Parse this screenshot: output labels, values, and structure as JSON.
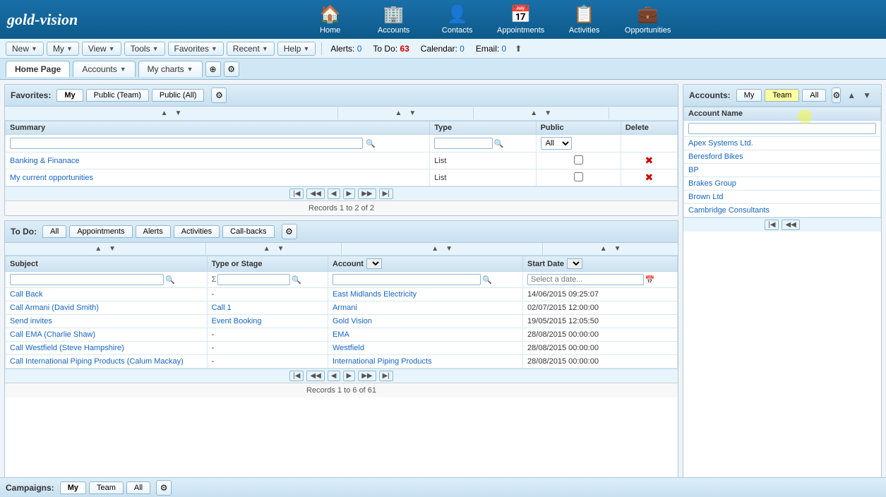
{
  "logo": {
    "text1": "gold-",
    "text2": "vision"
  },
  "nav": {
    "icons": [
      {
        "name": "home",
        "label": "Home",
        "symbol": "🏠"
      },
      {
        "name": "accounts",
        "label": "Accounts",
        "symbol": "🏢"
      },
      {
        "name": "contacts",
        "label": "Contacts",
        "symbol": "👤"
      },
      {
        "name": "appointments",
        "label": "Appointments",
        "symbol": "📅"
      },
      {
        "name": "activities",
        "label": "Activities",
        "symbol": "📋"
      },
      {
        "name": "opportunities",
        "label": "Opportunities",
        "symbol": "💼"
      }
    ]
  },
  "toolbar": {
    "new_label": "New",
    "my_label": "My",
    "view_label": "View",
    "tools_label": "Tools",
    "favorites_label": "Favorites",
    "recent_label": "Recent",
    "help_label": "Help",
    "alerts_label": "Alerts:",
    "alerts_count": "0",
    "todo_label": "To Do:",
    "todo_count": "63",
    "calendar_label": "Calendar:",
    "calendar_count": "0",
    "email_label": "Email:",
    "email_count": "0"
  },
  "tabs": {
    "home_page": "Home Page",
    "accounts": "Accounts",
    "my_charts": "My charts"
  },
  "favorites": {
    "label": "Favorites:",
    "tabs": [
      "My",
      "Public (Team)",
      "Public (All)"
    ],
    "columns": [
      "Summary",
      "Type",
      "Public",
      "Delete"
    ],
    "rows": [
      {
        "summary": "Banking & Finanace",
        "type": "List",
        "public": false,
        "delete": true
      },
      {
        "summary": "My current opportunities",
        "type": "List",
        "public": false,
        "delete": true
      }
    ],
    "records_info": "Records 1 to 2 of 2"
  },
  "todo": {
    "label": "To Do:",
    "tabs": [
      "All",
      "Appointments",
      "Alerts",
      "Activities",
      "Call-backs"
    ],
    "active_tab": "All",
    "columns": [
      "Subject",
      "Type or Stage",
      "Account",
      "Start Date"
    ],
    "rows": [
      {
        "subject": "Call Back",
        "type": "-",
        "account": "East Midlands Electricity",
        "start_date": "14/06/2015 09:25:07"
      },
      {
        "subject": "Call Armani (David Smith)",
        "type": "Call 1",
        "account": "Armani",
        "start_date": "02/07/2015 12:00:00"
      },
      {
        "subject": "Send invites",
        "type": "Event Booking",
        "account": "Gold Vision",
        "start_date": "19/05/2015 12:05:50"
      },
      {
        "subject": "Call EMA (Charlie Shaw)",
        "type": "-",
        "account": "EMA",
        "start_date": "28/08/2015 00:00:00"
      },
      {
        "subject": "Call Westfield (Steve Hampshire)",
        "type": "-",
        "account": "Westfield",
        "start_date": "28/08/2015 00:00:00"
      },
      {
        "subject": "Call International Piping Products (Calum Mackay)",
        "type": "-",
        "account": "International Piping Products",
        "start_date": "28/08/2015 00:00:00"
      }
    ],
    "records_info": "Records 1 to 6 of 61",
    "date_placeholder": "Select a date..."
  },
  "accounts_panel": {
    "label": "Accounts:",
    "tabs": [
      "My",
      "Team",
      "All"
    ],
    "active_tab": "Team",
    "column": "Account Name",
    "rows": [
      "Apex Systems Ltd.",
      "Beresford Bikes",
      "BP",
      "Brakes Group",
      "Brown Ltd",
      "Cambridge Consultants"
    ]
  },
  "campaigns": {
    "label": "Campaigns:",
    "tabs": [
      "My",
      "Team",
      "All"
    ]
  }
}
